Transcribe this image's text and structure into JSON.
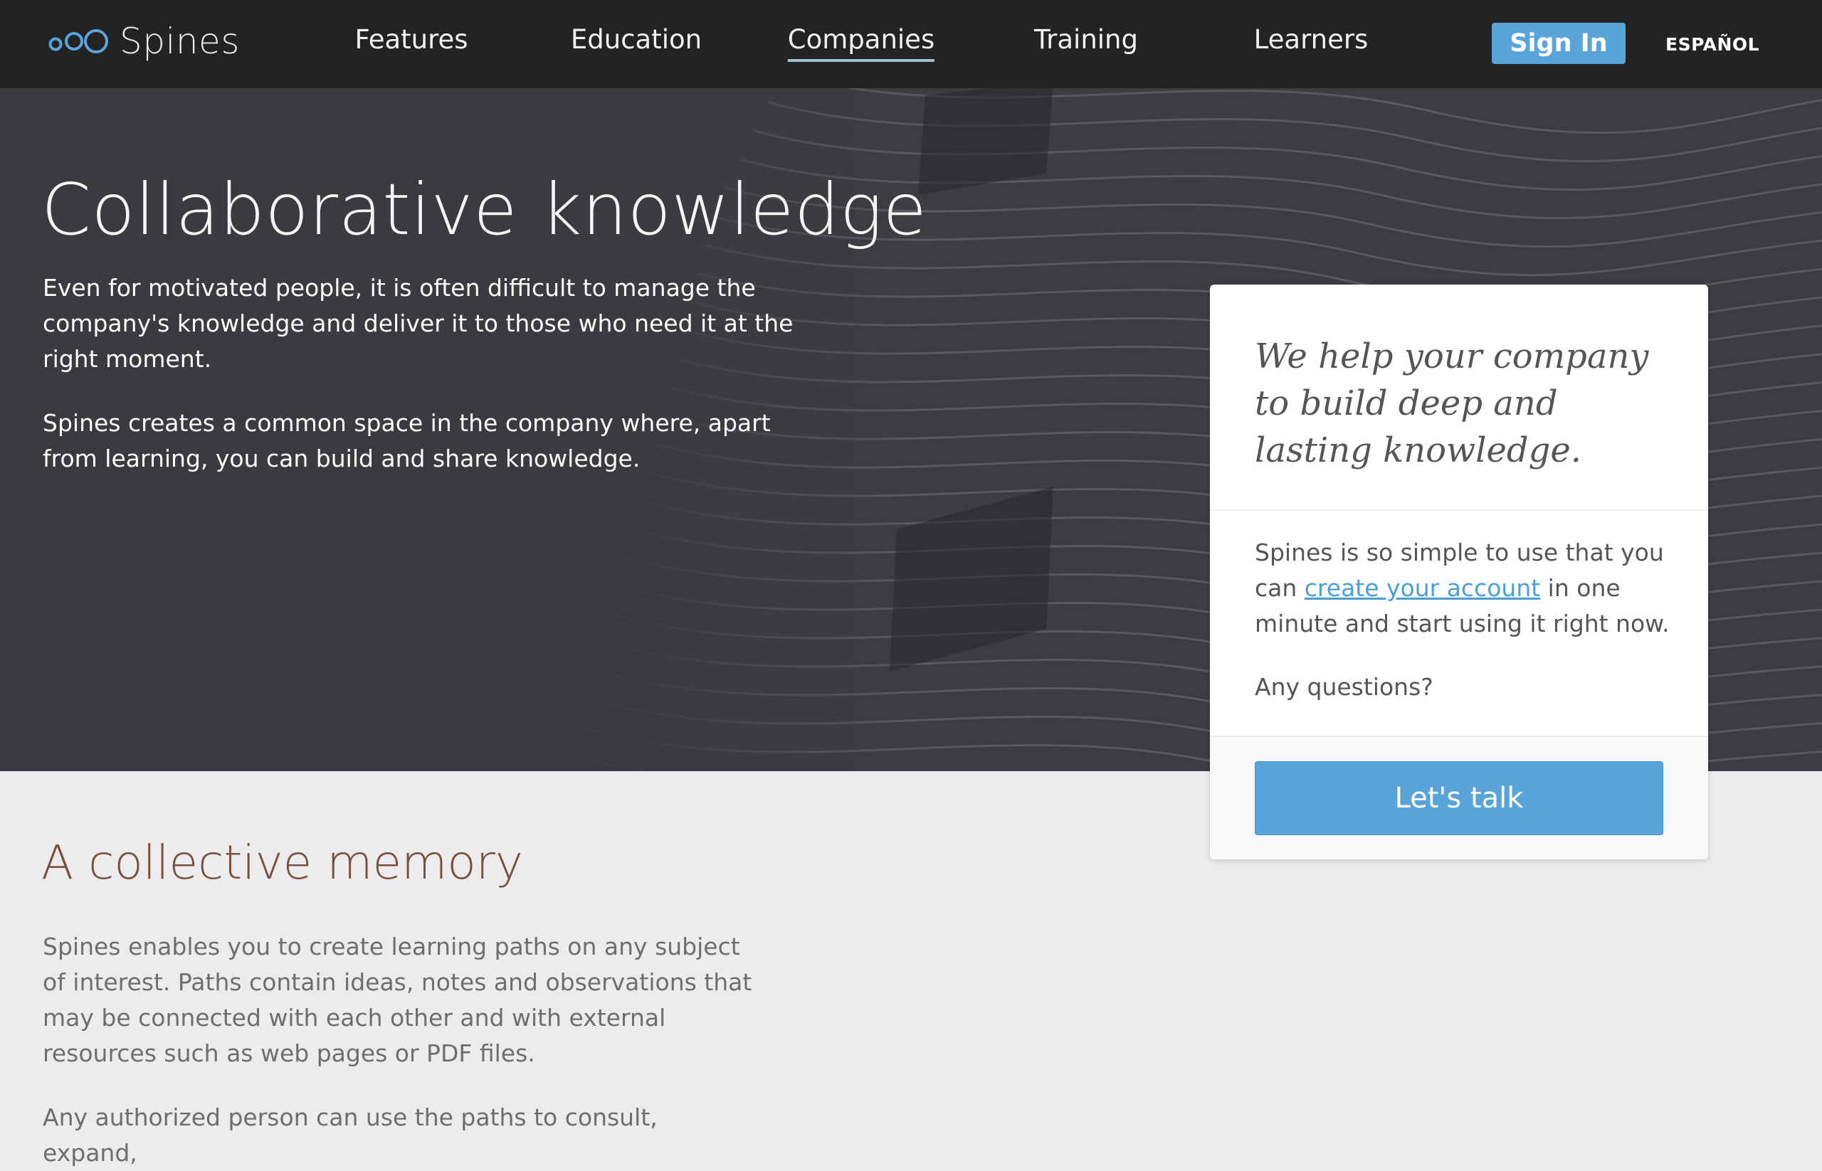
{
  "brand": {
    "name": "Spines",
    "logo_color": "#5aa4dc"
  },
  "nav": {
    "items": [
      {
        "label": "Features"
      },
      {
        "label": "Education"
      },
      {
        "label": "Companies",
        "active": true
      },
      {
        "label": "Training"
      },
      {
        "label": "Learners"
      }
    ],
    "signin_label": "Sign In",
    "language_label": "ESPAÑOL"
  },
  "hero": {
    "title": "Collaborative knowledge",
    "paragraphs": [
      "Even for motivated people, it is often difficult to manage the company's knowledge and deliver it to those who need it at the right moment.",
      "Spines creates a common space in the company where, apart from learning, you can build and share knowledge."
    ]
  },
  "card": {
    "quote": "We help your company to build deep and lasting knowledge.",
    "body_before": "Spines is so simple to use that you can ",
    "link_label": "create your account",
    "body_after": " in one minute and start using it right now.",
    "question": "Any questions?",
    "cta_label": "Let's talk"
  },
  "section": {
    "title": "A collective memory",
    "paragraphs": [
      "Spines enables you to create learning paths on any subject of interest. Paths contain ideas, notes and observations that may be connected with each other and with external resources such as web pages or PDF files.",
      "Any authorized person can use the paths to consult, expand,"
    ]
  },
  "colors": {
    "accent": "#5aa4dc",
    "nav_bg": "#232323",
    "section_title": "#7a4f3c"
  }
}
